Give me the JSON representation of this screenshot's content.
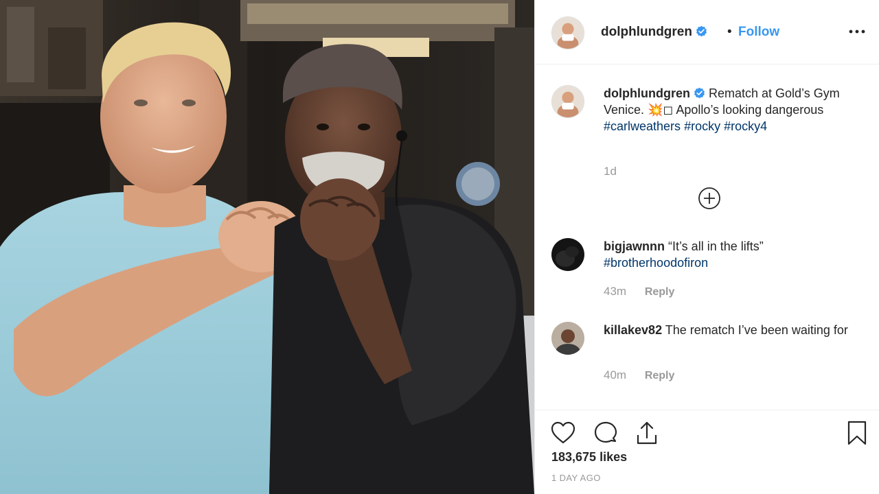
{
  "post": {
    "username": "dolphlundgren",
    "follow_label": "Follow",
    "dot": "•",
    "verified": true,
    "photo_alt": "Two men posing with fists raised outside a gym"
  },
  "caption": {
    "username": "dolphlundgren",
    "text_before": "Rematch at Gold’s Gym Venice. 💥◻ Apollo’s looking dangerous",
    "hashtags": [
      "#carlweathers",
      "#rocky",
      "#rocky4"
    ],
    "time": "1d"
  },
  "comments": [
    {
      "username": "bigjawnnn",
      "text": "“It’s all in the lifts”",
      "hashtag": "#brotherhoodofiron",
      "time": "43m",
      "reply_label": "Reply"
    },
    {
      "username": "killakev82",
      "text": "The rematch I’ve been waiting for",
      "time": "40m",
      "reply_label": "Reply"
    }
  ],
  "footer": {
    "likes": "183,675 likes",
    "posted": "1 DAY AGO"
  },
  "colors": {
    "accent": "#3897f0",
    "hashtag": "#003569",
    "muted": "#999999",
    "text": "#262626",
    "divider": "#efefef"
  },
  "icons": [
    "more-icon",
    "verified-icon",
    "expand-icon",
    "heart-icon",
    "comment-icon",
    "share-icon",
    "bookmark-icon"
  ]
}
